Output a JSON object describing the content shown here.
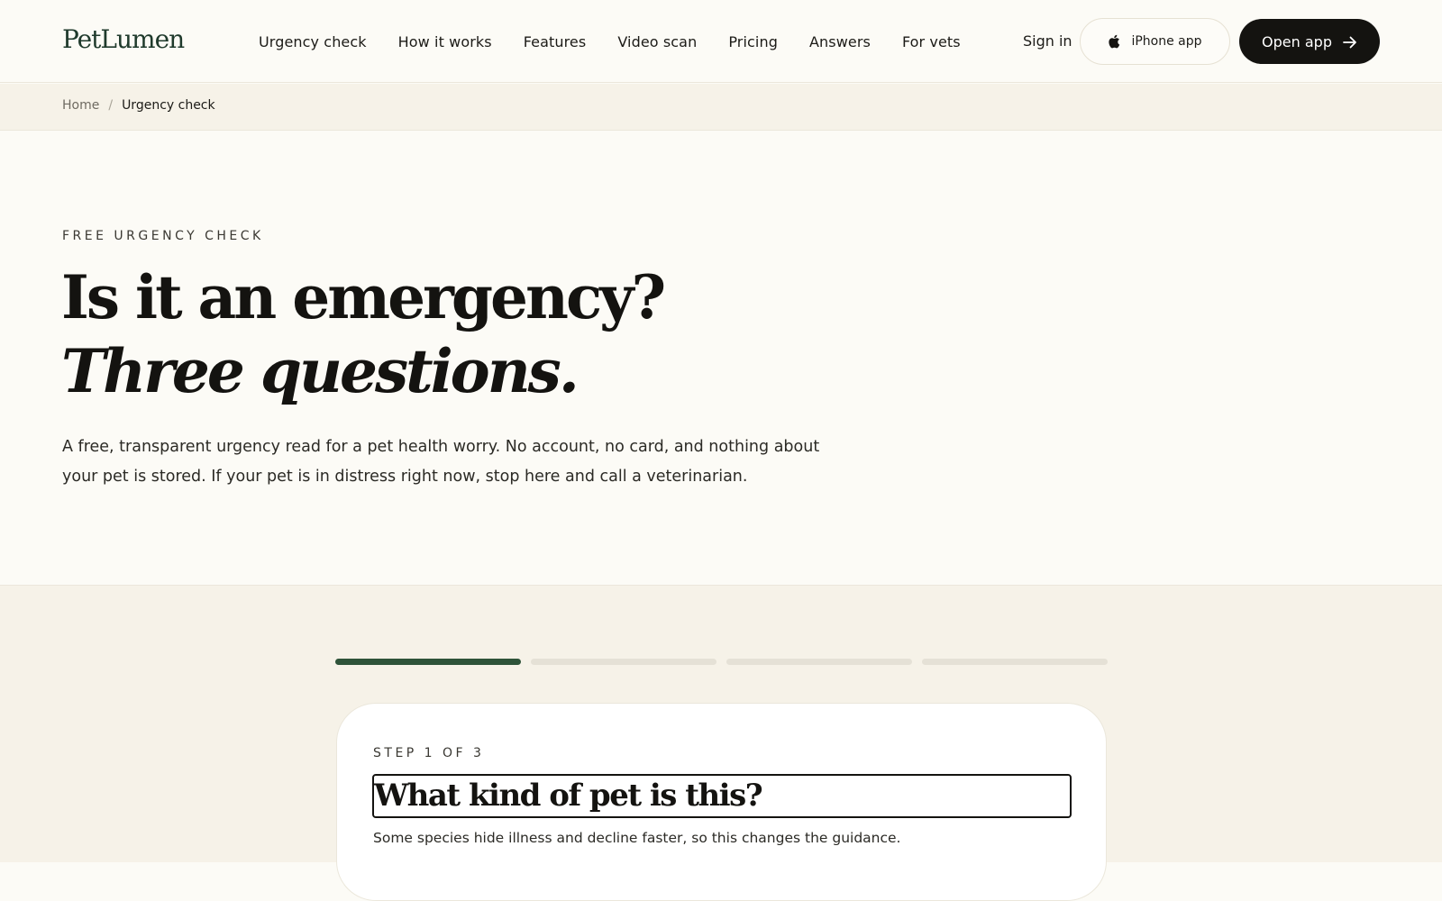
{
  "header": {
    "logo": "PetLumen",
    "nav": [
      {
        "label": "Urgency check"
      },
      {
        "label": "How it works"
      },
      {
        "label": "Features"
      },
      {
        "label": "Video scan"
      },
      {
        "label": "Pricing"
      },
      {
        "label": "Answers"
      },
      {
        "label": "For vets"
      }
    ],
    "sign_in": "Sign in",
    "iphone_app": "iPhone app",
    "open_app": "Open app",
    "icons": {
      "iphone": "apple-icon",
      "open_app": "arrow-right-icon"
    }
  },
  "breadcrumb": {
    "home": "Home",
    "separator": "/",
    "current": "Urgency check"
  },
  "hero": {
    "eyebrow": "FREE URGENCY CHECK",
    "title_line1": "Is it an emergency?",
    "title_line2": "Three questions.",
    "description": "A free, transparent urgency read for a pet health worry. No account, no card, and nothing about your pet is stored. If your pet is in distress right now, stop here and call a veterinarian."
  },
  "quiz": {
    "progress": {
      "total_segments": 4,
      "completed_segments": 1
    },
    "step_label": "STEP 1 OF 3",
    "question": "What kind of pet is this?",
    "help_text": "Some species hide illness and decline faster, so this changes the guidance."
  },
  "colors": {
    "background": "#fcfbf6",
    "band": "#f6f2e8",
    "accent_green": "#2e5339",
    "dark_button": "#141310",
    "logo": "#1f3a2c"
  }
}
